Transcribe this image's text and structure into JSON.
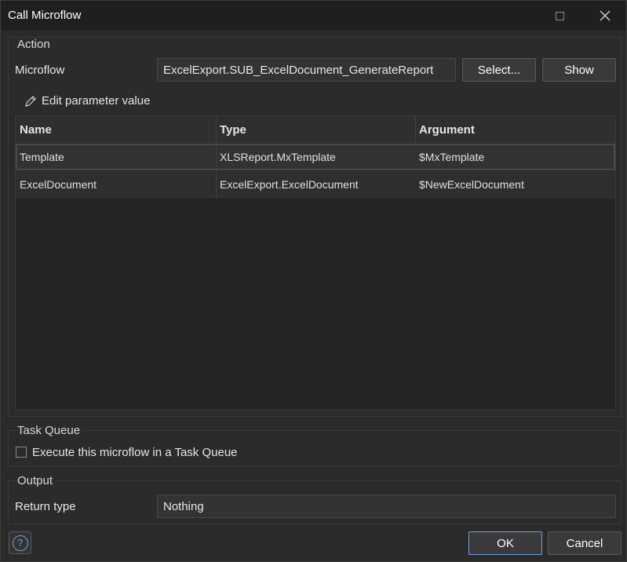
{
  "window": {
    "title": "Call Microflow"
  },
  "action": {
    "group_label": "Action",
    "microflow_label": "Microflow",
    "microflow_value": "ExcelExport.SUB_ExcelDocument_GenerateReport",
    "select_label": "Select...",
    "show_label": "Show",
    "edit_param_label": "Edit parameter value"
  },
  "parameters": {
    "columns": [
      "Name",
      "Type",
      "Argument"
    ],
    "rows": [
      {
        "name": "Template",
        "type": "XLSReport.MxTemplate",
        "argument": "$MxTemplate"
      },
      {
        "name": "ExcelDocument",
        "type": "ExcelExport.ExcelDocument",
        "argument": "$NewExcelDocument"
      }
    ],
    "selected_row": 0
  },
  "task_queue": {
    "group_label": "Task Queue",
    "checkbox_label": "Execute this microflow in a Task Queue",
    "checked": false
  },
  "output": {
    "group_label": "Output",
    "return_type_label": "Return type",
    "return_type_value": "Nothing"
  },
  "footer": {
    "help_icon": "?",
    "ok_label": "OK",
    "cancel_label": "Cancel"
  },
  "colors": {
    "accent": "#6aa0e0",
    "background": "#2b2b2b",
    "titlebar": "#1f1f1f"
  }
}
